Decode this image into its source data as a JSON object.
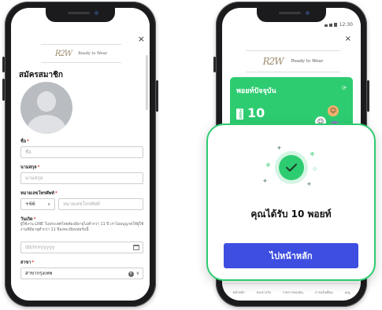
{
  "register_screen": {
    "logo_mark": "R2W",
    "logo_text": "Ready to Wear",
    "close_label": "×",
    "title": "สมัครสมาชิก",
    "fields": {
      "first_name": {
        "label": "ชื่อ",
        "required": "*",
        "placeholder": "ชื่อ"
      },
      "last_name": {
        "label": "นามสกุล",
        "required": "*",
        "placeholder": "นามสกุล"
      },
      "phone": {
        "label": "หมายเลขโทรศัพท์",
        "required": "*",
        "country_code": "+66",
        "country_chevron": "∨",
        "placeholder": "หมายเลขโทรศัพท์"
      },
      "birthday": {
        "label": "วันเกิด",
        "required": "*",
        "hint": "ผู้ใช้งาน LINE ในประเทศไทยต้องมีอายุไม่ต่ำกว่า 11 ปี เราไม่อนุญาตให้ผู้ใช้งานที่มีอายุต่ำกว่า 11 ปีลงทะเบียนฟอร์มนี้",
        "placeholder": "dd/mm/yyyy"
      },
      "branch": {
        "label": "สาขา",
        "required": "*",
        "value": "สาขากรุงเทพ",
        "clear_label": "×",
        "chevron": "∨"
      }
    }
  },
  "points_screen": {
    "status_time": "12:30",
    "close_label": "×",
    "logo_mark": "R2W",
    "logo_text": "Ready to Wear",
    "card": {
      "title": "พอยท์ปัจจุบัน",
      "badge": "POINT",
      "value": "10",
      "refresh_icon": "⟳"
    },
    "bottom_nav": [
      "หน้าหลัก",
      "ของรางวัล",
      "รายการของฉัน",
      "การแจ้งเตือน",
      "เมนู"
    ]
  },
  "success_modal": {
    "message": "คุณได้รับ 10 พอยท์",
    "button_label": "ไปหน้าหลัก",
    "accent_color": "#2ecc71",
    "button_color": "#3d4ee0"
  }
}
